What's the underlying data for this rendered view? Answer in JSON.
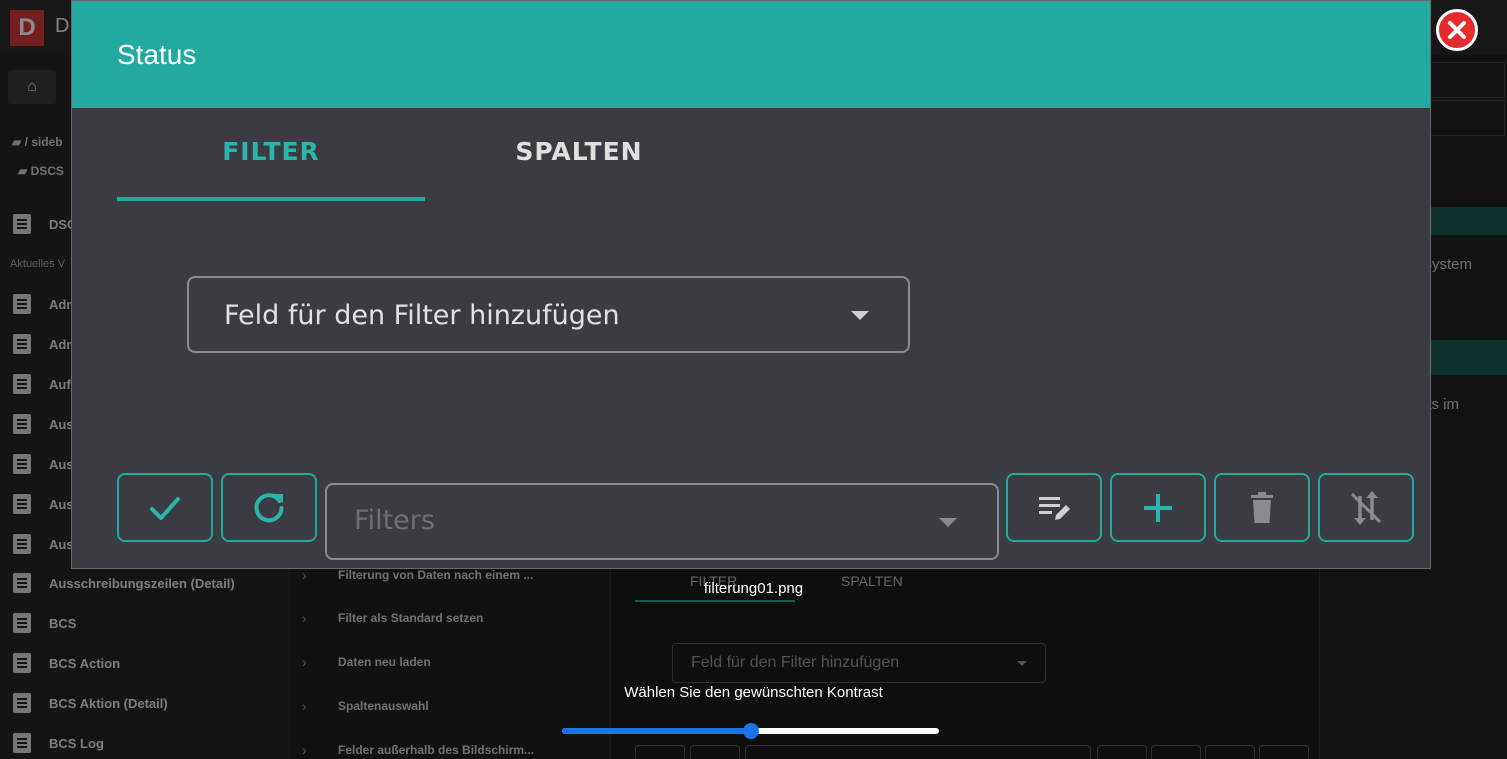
{
  "background": {
    "app_title": "D",
    "logo_letter": "D",
    "breadcrumbs": [
      "/ sideb",
      "DSCS"
    ],
    "section_label": "Aktuelles V",
    "sidebar_items": [
      "DSC",
      "Adm",
      "Adm",
      "Auf",
      "Aus",
      "Aus",
      "Aus",
      "Aus",
      "Ausschreibungszeilen (Detail)",
      "BCS",
      "BCS Action",
      "BCS Aktion (Detail)",
      "BCS Log"
    ],
    "middle_items": [
      "Filterung von Daten nach einem ...",
      "Filter als Standard setzen",
      "Daten neu laden",
      "Spaltenauswahl",
      "Felder außerhalb des Bildschirm..."
    ],
    "right_texts": [
      "System",
      "nts im"
    ],
    "tab_filter": "FILTER",
    "tab_spalten": "SPALTEN",
    "select_placeholder": "Feld für den Filter hinzufügen"
  },
  "modal": {
    "title": "Status",
    "tabs": [
      {
        "label": "FILTER",
        "active": true
      },
      {
        "label": "SPALTEN",
        "active": false
      }
    ],
    "field_select_label": "Feld für den Filter hinzufügen",
    "filters_placeholder": "Filters",
    "buttons": [
      {
        "name": "apply",
        "icon": "check-icon"
      },
      {
        "name": "reload",
        "icon": "refresh-icon"
      },
      {
        "name": "edit",
        "icon": "edit-list-icon"
      },
      {
        "name": "add",
        "icon": "plus-icon"
      },
      {
        "name": "delete",
        "icon": "trash-icon"
      },
      {
        "name": "sort-off",
        "icon": "sort-off-icon"
      }
    ]
  },
  "overlay": {
    "filename": "filterung01.png",
    "contrast_label": "Wählen Sie den gewünschten Kontrast",
    "contrast_value": 0.5
  },
  "colors": {
    "accent": "#22aaa0",
    "modal_bg": "#3b3b42",
    "close_red": "#e52b2b",
    "slider_blue": "#1a73e8"
  }
}
